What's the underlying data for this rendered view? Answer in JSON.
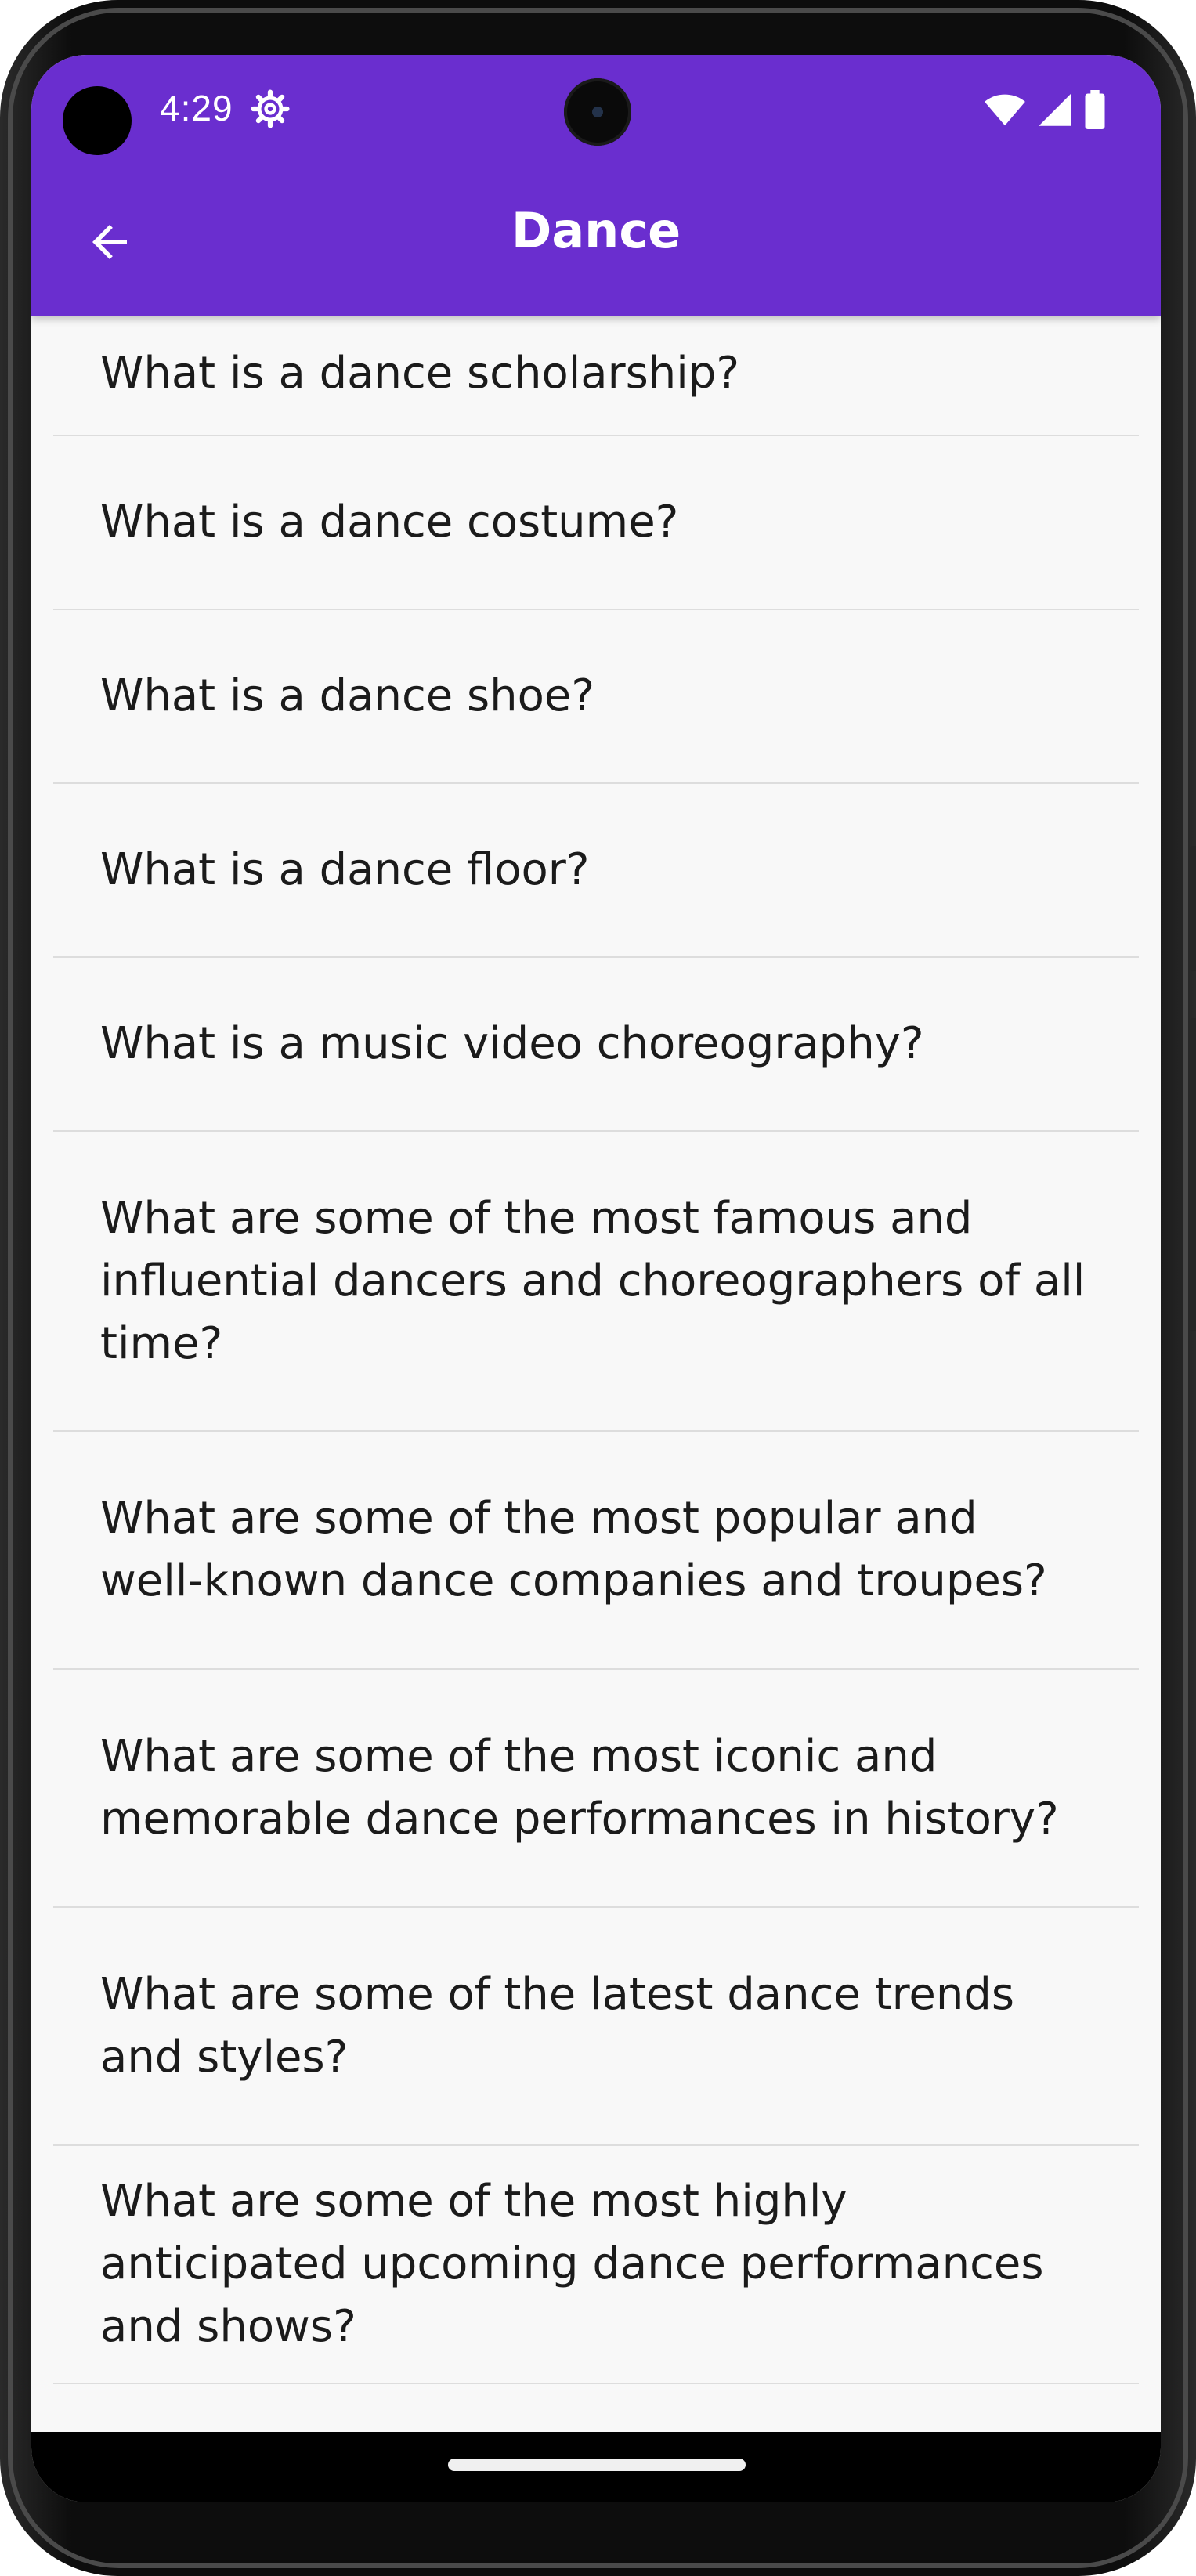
{
  "status_bar": {
    "time": "4:29",
    "icons": [
      "settings-gear-icon",
      "wifi-icon",
      "cellular-signal-icon",
      "battery-icon"
    ]
  },
  "app_bar": {
    "title": "Dance",
    "back_icon": "arrow-back-icon"
  },
  "colors": {
    "primary": "#6a2ecf",
    "background": "#f8f8f8",
    "divider": "#dddddd",
    "text": "#1b1b1b"
  },
  "questions": [
    "What is a dance scholarship?",
    "What is a dance costume?",
    "What is a dance shoe?",
    "What is a dance floor?",
    "What is a music video choreography?",
    "What are some of the most famous and influential dancers and choreographers of all time?",
    "What are some of the most popular and well-known dance companies and troupes?",
    "What are some of the most iconic and memorable dance performances in history?",
    "What are some of the latest dance trends and styles?",
    "What are some of the most highly anticipated upcoming dance performances and shows?"
  ]
}
